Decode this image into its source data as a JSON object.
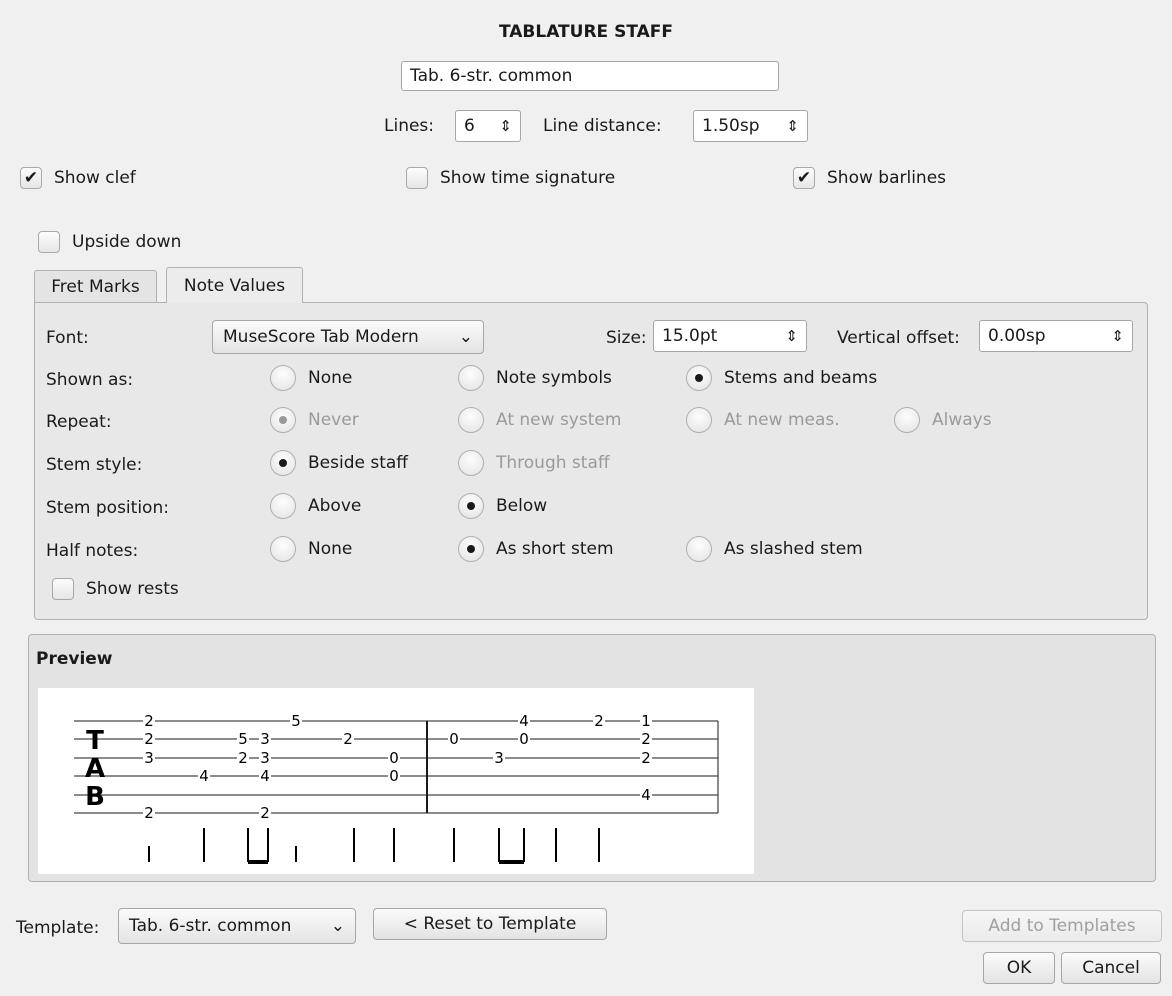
{
  "dialog": {
    "title": "TABLATURE STAFF",
    "name_value": "Tab. 6-str. common",
    "lines_label": "Lines:",
    "lines_value": "6",
    "line_distance_label": "Line distance:",
    "line_distance_value": "1.50sp",
    "show_clef": {
      "label": "Show clef",
      "checked": true
    },
    "show_time_signature": {
      "label": "Show time signature",
      "checked": false
    },
    "show_barlines": {
      "label": "Show barlines",
      "checked": true
    },
    "upside_down": {
      "label": "Upside down",
      "checked": false
    }
  },
  "tabs": [
    {
      "label": "Fret Marks",
      "active": false
    },
    {
      "label": "Note Values",
      "active": true
    }
  ],
  "note_values": {
    "font_label": "Font:",
    "font_value": "MuseScore Tab Modern",
    "size_label": "Size:",
    "size_value": "15.0pt",
    "vertical_offset_label": "Vertical offset:",
    "vertical_offset_value": "0.00sp",
    "shown_as": {
      "label": "Shown as:",
      "options": [
        "None",
        "Note symbols",
        "Stems and beams"
      ],
      "selected": "Stems and beams"
    },
    "repeat": {
      "label": "Repeat:",
      "options": [
        "Never",
        "At new system",
        "At new meas.",
        "Always"
      ],
      "selected": "Never",
      "disabled": true
    },
    "stem_style": {
      "label": "Stem style:",
      "options": [
        "Beside staff",
        "Through staff"
      ],
      "selected": "Beside staff"
    },
    "stem_position": {
      "label": "Stem position:",
      "options": [
        "Above",
        "Below"
      ],
      "selected": "Below"
    },
    "half_notes": {
      "label": "Half notes:",
      "options": [
        "None",
        "As short stem",
        "As slashed stem"
      ],
      "selected": "As short stem"
    },
    "show_rests": {
      "label": "Show rests",
      "checked": false
    }
  },
  "preview": {
    "label": "Preview",
    "clef": [
      "T",
      "A",
      "B"
    ],
    "fret_numbers": [
      [
        "2",
        "2",
        "3",
        "",
        "",
        "2"
      ],
      [
        "",
        "",
        "",
        "4",
        "",
        ""
      ],
      [
        "",
        "5",
        "2",
        "",
        "",
        ""
      ],
      [
        "",
        "3",
        "3",
        "4",
        "",
        "2"
      ],
      [
        "5",
        "",
        "",
        "",
        "",
        ""
      ],
      [
        "",
        "2",
        "",
        "",
        "",
        ""
      ],
      [
        "",
        "",
        "0",
        "0",
        "",
        ""
      ],
      [
        "",
        "0",
        "",
        "",
        "",
        ""
      ],
      [
        "",
        "",
        "3",
        "",
        "",
        ""
      ],
      [
        "4",
        "0",
        "",
        "",
        "",
        ""
      ],
      [
        "2",
        "",
        "",
        "",
        "",
        ""
      ],
      [
        "1",
        "2",
        "2",
        "",
        "4",
        ""
      ]
    ]
  },
  "footer": {
    "template_label": "Template:",
    "template_value": "Tab. 6-str. common",
    "reset_label": "< Reset to Template",
    "add_label": "Add to Templates",
    "ok_label": "OK",
    "cancel_label": "Cancel"
  }
}
